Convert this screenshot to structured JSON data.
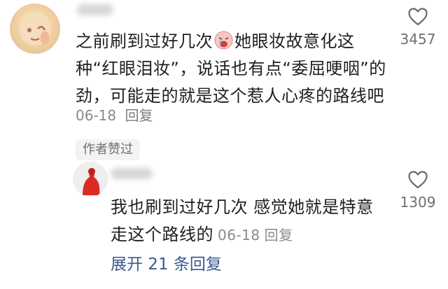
{
  "main_comment": {
    "text_before_emoji": "之前刷到过好几次",
    "text_after_emoji": "她眼妆故意化这种“红眼泪妆”，说话也有点“委屈哽咽”的劲，可能走的就是这个惹人心疼的路线吧",
    "date": "06-18",
    "reply_label": "回复",
    "like_count": "3457",
    "badge": "作者赞过"
  },
  "reply_comment": {
    "text": "我也刷到过好几次 感觉她就是特意走这个路线的",
    "date": "06-18",
    "reply_label": "回复",
    "like_count": "1309"
  },
  "expand": {
    "label": "展开 21 条回复"
  },
  "icons": {
    "like": "heart-outline-icon",
    "emoji": "crying-face-emoji-icon"
  },
  "colors": {
    "link_blue": "#3a5a8c",
    "meta_gray": "#8a8a8a"
  }
}
